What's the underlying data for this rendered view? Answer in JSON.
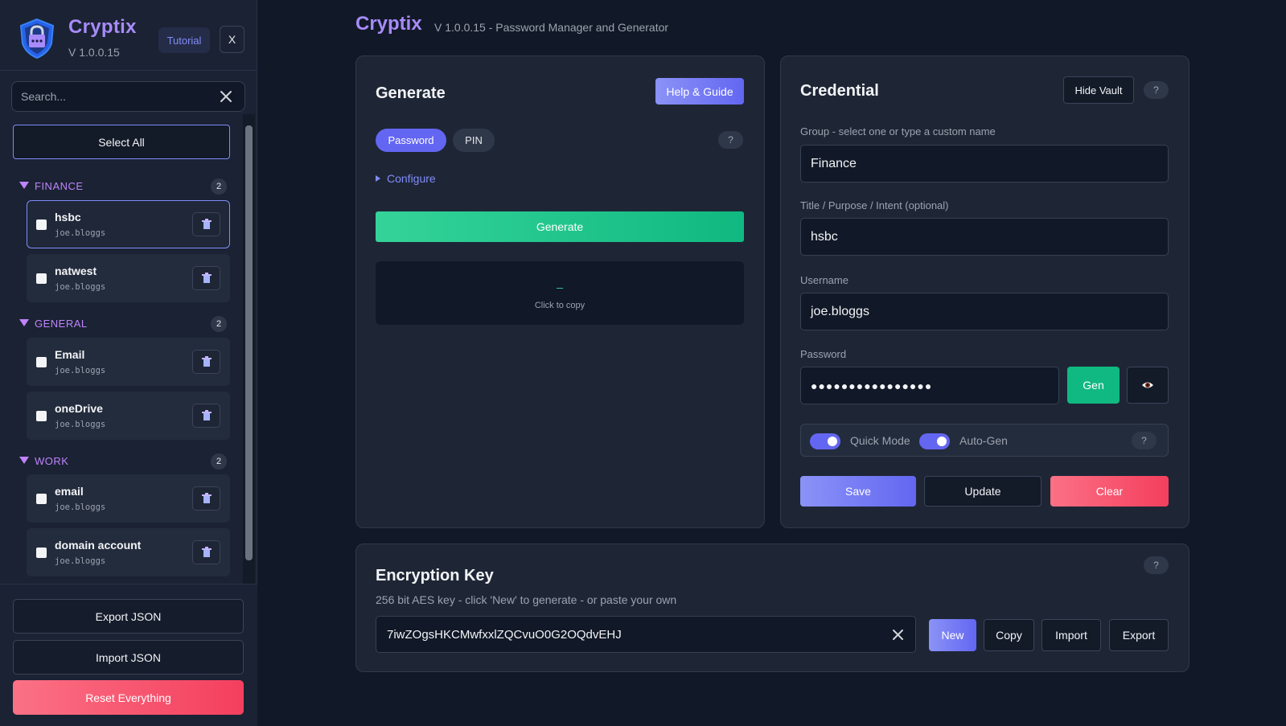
{
  "brand": {
    "name": "Cryptix",
    "version": "V 1.0.0.15",
    "tutorial_label": "Tutorial",
    "close_label": "X"
  },
  "sidebar": {
    "search_placeholder": "Search...",
    "select_all_label": "Select All",
    "groups": [
      {
        "name": "FINANCE",
        "count": "2",
        "items": [
          {
            "title": "hsbc",
            "user": "joe.bloggs",
            "active": true
          },
          {
            "title": "natwest",
            "user": "joe.bloggs"
          }
        ]
      },
      {
        "name": "GENERAL",
        "count": "2",
        "items": [
          {
            "title": "Email",
            "user": "joe.bloggs"
          },
          {
            "title": "oneDrive",
            "user": "joe.bloggs"
          }
        ]
      },
      {
        "name": "WORK",
        "count": "2",
        "items": [
          {
            "title": "email",
            "user": "joe.bloggs"
          },
          {
            "title": "domain account",
            "user": "joe.bloggs"
          }
        ]
      }
    ],
    "export_label": "Export JSON",
    "import_label": "Import JSON",
    "reset_label": "Reset Everything"
  },
  "header": {
    "title": "Cryptix",
    "subtitle": "V 1.0.0.15 - Password Manager and Generator"
  },
  "generate": {
    "title": "Generate",
    "help_label": "Help & Guide",
    "tab_password": "Password",
    "tab_pin": "PIN",
    "question": "?",
    "configure_label": "Configure",
    "generate_label": "Generate",
    "output": "_",
    "output_hint": "Click to copy"
  },
  "credential": {
    "title": "Credential",
    "hide_vault_label": "Hide Vault",
    "question": "?",
    "group_label": "Group - select one or type a custom name",
    "group_value": "Finance",
    "title_label": "Title / Purpose / Intent (optional)",
    "title_value": "hsbc",
    "username_label": "Username",
    "username_value": "joe.bloggs",
    "password_label": "Password",
    "password_value": "●●●●●●●●●●●●●●●●",
    "gen_label": "Gen",
    "quick_mode_label": "Quick Mode",
    "auto_gen_label": "Auto-Gen",
    "save_label": "Save",
    "update_label": "Update",
    "clear_label": "Clear"
  },
  "encryption": {
    "title": "Encryption Key",
    "question": "?",
    "description": "256 bit AES key - click 'New' to generate - or paste your own",
    "key_value": "7iwZOgsHKCMwfxxlZQCvuO0G2OQdvEHJ",
    "new_label": "New",
    "copy_label": "Copy",
    "import_label": "Import",
    "export_label": "Export"
  }
}
